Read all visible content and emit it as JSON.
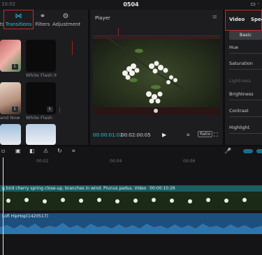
{
  "topbar": {
    "time_left": "10:02",
    "title": "0504"
  },
  "left_panel": {
    "tabs": [
      {
        "label": "Transitions",
        "icon": "bowtie-icon"
      },
      {
        "label": "Filters",
        "icon": "filters-icon"
      },
      {
        "label": "Adjustment",
        "icon": "sliders-icon"
      }
    ],
    "partial_tab_label": "ts",
    "items": [
      {
        "label": ""
      },
      {
        "label": "White Flash II"
      },
      {
        "label": "and Now"
      },
      {
        "label": "White Flash"
      },
      {
        "label": ""
      },
      {
        "label": ""
      }
    ]
  },
  "player": {
    "title": "Player",
    "current_time": "00:00:01:02",
    "total_time": "00:02:00:05",
    "ratio_label": "Ratio"
  },
  "right_panel": {
    "tab_video": "Video",
    "tab_speed": "Spee",
    "basic_button": "Basic",
    "props": [
      "Hue",
      "Saturation",
      "Lightness",
      "Brightness",
      "Contrast",
      "Highlight"
    ]
  },
  "timeline": {
    "ruler": [
      "00:02",
      "00:04",
      "00:06"
    ],
    "video_clip_label": "g bird cherry spring close-up, branches in wind. Prunus padus. Video",
    "video_clip_duration": "00:00:10:26",
    "audio_clip_label": "Lofi HipHop(1420517)"
  },
  "colors": {
    "accent": "#27c7d8",
    "video_track": "#1c6b6f",
    "audio_track": "#1d4f7c",
    "highlight_box": "#c22b2b"
  }
}
